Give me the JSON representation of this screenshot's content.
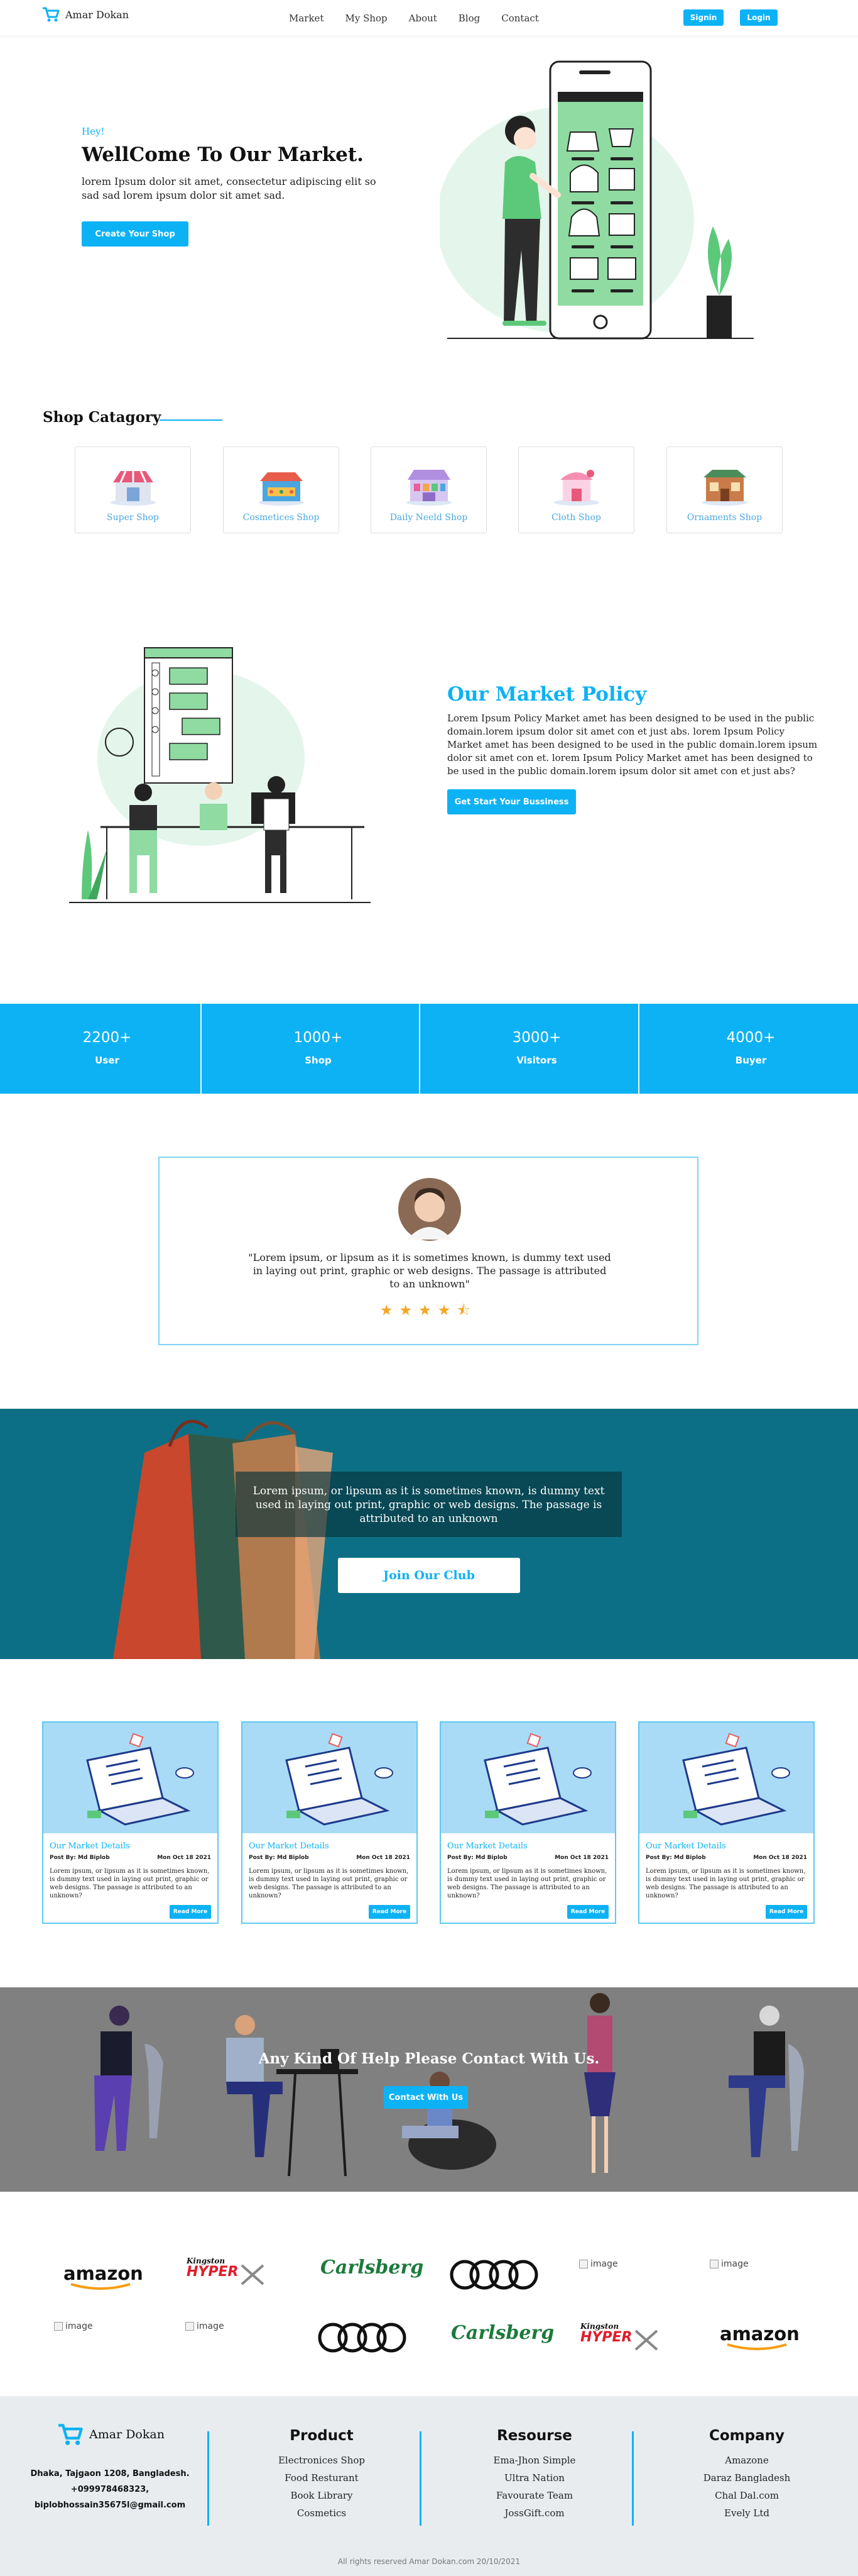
{
  "nav": {
    "brand": "Amar Dokan",
    "links": [
      "Market",
      "My Shop",
      "About",
      "Blog",
      "Contact"
    ],
    "signin": "Signin",
    "login": "Login",
    "accent": "#0db2f5"
  },
  "hero": {
    "greeting": "Hey!",
    "title": "WellCome To Our Market.",
    "subtitle": "lorem Ipsum dolor sit amet, consectetur adipiscing elit so sad sad lorem ipsum dolor sit amet sad.",
    "cta": "Create Your Shop"
  },
  "categories": {
    "title": "Shop Catagory",
    "items": [
      {
        "label": "Super Shop",
        "icon": "supershop-icon"
      },
      {
        "label": "Cosmetices Shop",
        "icon": "cosmetics-shop-icon"
      },
      {
        "label": "Daily Neeld Shop",
        "icon": "daily-need-shop-icon"
      },
      {
        "label": "Cloth Shop",
        "icon": "cloth-shop-icon"
      },
      {
        "label": "Ornaments Shop",
        "icon": "ornaments-shop-icon"
      }
    ]
  },
  "policy": {
    "title": "Our Market Policy",
    "text": "Lorem Ipsum Policy Market amet has been designed to be used in the public domain.lorem ipsum dolor sit amet con et just abs. lorem Ipsum Policy Market amet has been designed to be used in the public domain.lorem ipsum dolor sit amet con et. lorem Ipsum Policy Market amet has been designed to be used in the public domain.lorem ipsum dolor sit amet con et just abs?",
    "cta": "Get Start Your Bussiness"
  },
  "stats": [
    {
      "value": "2200+",
      "label": "User"
    },
    {
      "value": "1000+",
      "label": "Shop"
    },
    {
      "value": "3000+",
      "label": "Visitors"
    },
    {
      "value": "4000+",
      "label": "Buyer"
    }
  ],
  "testimonial": {
    "quote": "\"Lorem ipsum, or lipsum as it is sometimes known, is dummy text used in laying out print, graphic or web designs. The passage is attributed to an unknown\"",
    "rating": 4.5,
    "stars": "★★★★⯪"
  },
  "club": {
    "quote": "Lorem ipsum, or lipsum as it is sometimes known, is dummy text used in laying out print, graphic or web designs. The passage is attributed to an unknown",
    "cta": "Join Our Club"
  },
  "blogs": [
    {
      "title": "Our Market Details",
      "author": "Post By: Md Biplob",
      "date": "Mon Oct 18 2021",
      "text": "Lorem ipsum, or lipsum as it is sometimes known, is dummy text used in laying out print, graphic or web designs. The passage is attributed to an unknown?",
      "cta": "Read More"
    },
    {
      "title": "Our Market Details",
      "author": "Post By: Md Biplob",
      "date": "Mon Oct 18 2021",
      "text": "Lorem ipsum, or lipsum as it is sometimes known, is dummy text used in laying out print, graphic or web designs. The passage is attributed to an unknown?",
      "cta": "Read More"
    },
    {
      "title": "Our Market Details",
      "author": "Post By: Md Biplob",
      "date": "Mon Oct 18 2021",
      "text": "Lorem ipsum, or lipsum as it is sometimes known, is dummy text used in laying out print, graphic or web designs. The passage is attributed to an unknown?",
      "cta": "Read More"
    },
    {
      "title": "Our Market Details",
      "author": "Post By: Md Biplob",
      "date": "Mon Oct 18 2021",
      "text": "Lorem ipsum, or lipsum as it is sometimes known, is dummy text used in laying out print, graphic or web designs. The passage is attributed to an unknown?",
      "cta": "Read More"
    }
  ],
  "contact": {
    "title": "Any Kind Of Help Please Contact With Us.",
    "cta": "Contact With Us"
  },
  "partners": {
    "amazon": "amazon",
    "kingston": "Kingston",
    "hyperx": "HYPER",
    "carlsberg": "Carlsberg",
    "broken_alt": "image"
  },
  "footer": {
    "brand": "Amar Dokan",
    "address": "Dhaka, Tajgaon 1208, Bangladesh.",
    "phone": "+099978468323,",
    "email": "biplobhossain35675l@gmail.com",
    "product": {
      "title": "Product",
      "items": [
        "Electronices Shop",
        "Food Resturant",
        "Book Library",
        "Cosmetics"
      ]
    },
    "resource": {
      "title": "Resourse",
      "items": [
        "Ema-Jhon Simple",
        "Ultra Nation",
        "Favourate Team",
        "JossGift.com"
      ]
    },
    "company": {
      "title": "Company",
      "items": [
        "Amazone",
        "Daraz Bangladesh",
        "Chal Dal.com",
        "Evely Ltd"
      ]
    },
    "copyright": "All rights reserved Amar Dokan.com 20/10/2021"
  }
}
